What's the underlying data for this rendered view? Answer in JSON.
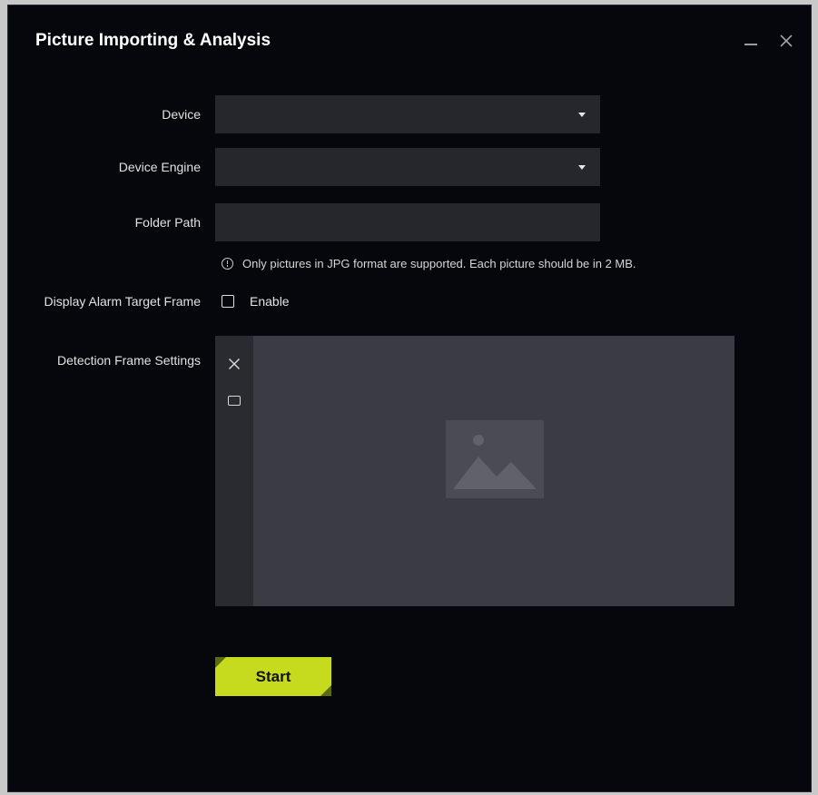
{
  "dialog": {
    "title": "Picture Importing & Analysis",
    "controls": {
      "minimize_icon": "minimize-icon",
      "close_icon": "close-icon"
    }
  },
  "form": {
    "device": {
      "label": "Device",
      "value": ""
    },
    "device_engine": {
      "label": "Device Engine",
      "value": ""
    },
    "folder_path": {
      "label": "Folder Path",
      "value": "",
      "placeholder": ""
    },
    "hint": {
      "icon": "info-icon",
      "text": "Only pictures in JPG format are supported. Each picture should be in 2 MB."
    },
    "display_alarm_target_frame": {
      "label": "Display Alarm Target Frame",
      "checkbox_label": "Enable",
      "checked": false
    },
    "detection_frame_settings": {
      "label": "Detection Frame Settings",
      "tools": [
        "clear-icon",
        "draw-rectangle-icon"
      ],
      "placeholder_icon": "image-placeholder-icon"
    }
  },
  "actions": {
    "start_label": "Start"
  },
  "colors": {
    "background": "#06070c",
    "field": "#26272d",
    "preview": "#3a3b43",
    "accent": "#c7db1e"
  }
}
